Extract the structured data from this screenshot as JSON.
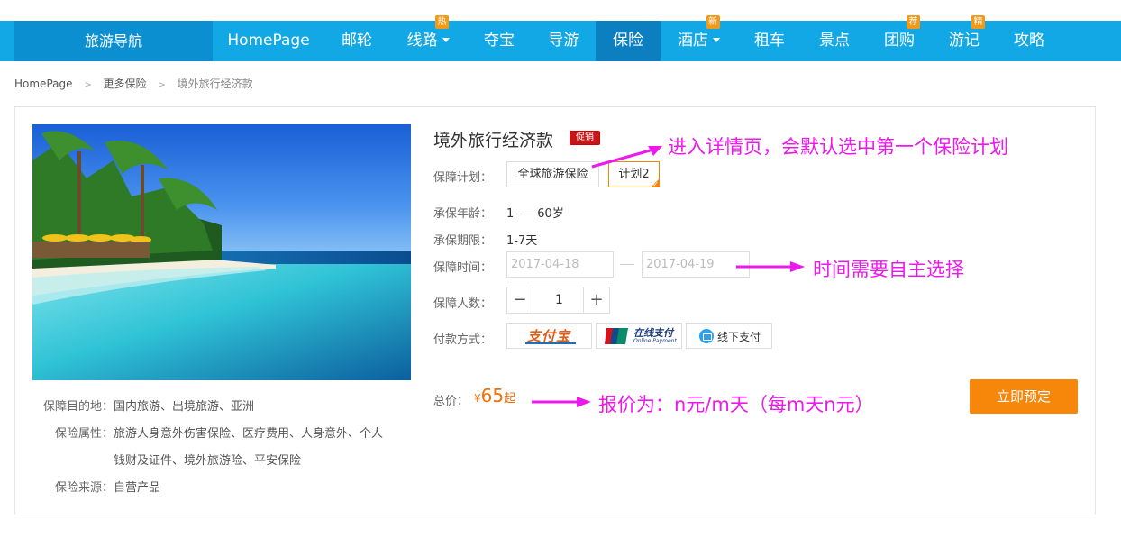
{
  "nav": {
    "brand": "旅游导航",
    "items": [
      {
        "label": "HomePage",
        "caret": false,
        "badge": "",
        "active": false
      },
      {
        "label": "邮轮",
        "caret": false,
        "badge": "",
        "active": false
      },
      {
        "label": "线路",
        "caret": true,
        "badge": "热",
        "active": false
      },
      {
        "label": "夺宝",
        "caret": false,
        "badge": "",
        "active": false
      },
      {
        "label": "导游",
        "caret": false,
        "badge": "",
        "active": false
      },
      {
        "label": "保险",
        "caret": false,
        "badge": "",
        "active": true
      },
      {
        "label": "酒店",
        "caret": true,
        "badge": "新",
        "active": false
      },
      {
        "label": "租车",
        "caret": false,
        "badge": "",
        "active": false
      },
      {
        "label": "景点",
        "caret": false,
        "badge": "",
        "active": false
      },
      {
        "label": "团购",
        "caret": false,
        "badge": "荐",
        "active": false
      },
      {
        "label": "游记",
        "caret": false,
        "badge": "精",
        "active": false
      },
      {
        "label": "攻略",
        "caret": false,
        "badge": "",
        "active": false
      }
    ],
    "colors": {
      "bar": "#12a8e6",
      "brand_bg": "#0b8fd0",
      "active_bg": "#0b7fc0",
      "badge": "#f19a1a"
    }
  },
  "breadcrumb": {
    "home": "HomePage",
    "sep": ">",
    "level2": "更多保险",
    "current": "境外旅行经济款"
  },
  "product": {
    "title": "境外旅行经济款",
    "tag": "促销",
    "plan_label": "保障计划：",
    "plans": [
      "全球旅游保险",
      "计划2"
    ],
    "selected_plan": "计划2",
    "age_label": "承保年龄：",
    "age_value": "1——60岁",
    "term_label": "承保期限：",
    "term_value": "1-7天",
    "date_label": "保障时间：",
    "date_start": "2017-04-18",
    "date_end": "2017-04-19",
    "people_label": "保障人数：",
    "people_count": "1",
    "minus": "−",
    "plus": "+",
    "pay_label": "付款方式：",
    "pay_alipay": "支付宝",
    "pay_unionpay_cn": "在线支付",
    "pay_unionpay_en": "Online Payment",
    "pay_offline": "线下支付",
    "price_label": "总价：",
    "price_currency": "¥",
    "price_value": "65",
    "price_unit": "起",
    "book_button": "立即预定",
    "accent_color": "#f7870a"
  },
  "details": {
    "dest_label": "保障目的地：",
    "dest_value": "国内旅游、出境旅游、亚洲",
    "attr_label": "保险属性：",
    "attr_value_line1": "旅游人身意外伤害保险、医疗费用、人身意外、个人",
    "attr_value_line2": "钱财及证件、境外旅游险、平安保险",
    "source_label": "保险来源：",
    "source_value": "自营产品"
  },
  "annotations": {
    "note1": "进入详情页，会默认选中第一个保险计划",
    "note2": "时间需要自主选择",
    "note3": "报价为：n元/m天（每m天n元）",
    "color": "#ee18ee"
  }
}
